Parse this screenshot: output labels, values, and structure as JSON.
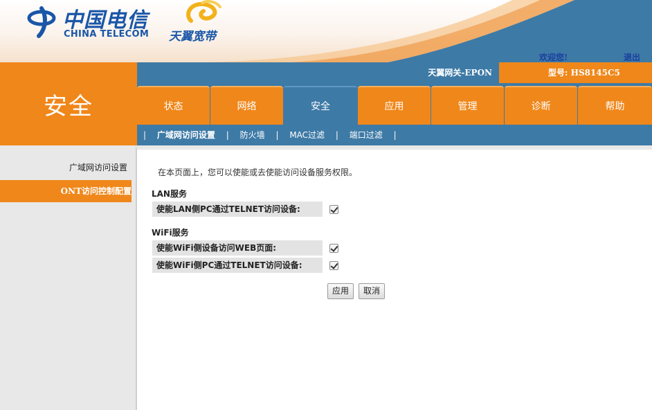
{
  "header": {
    "brand_cn": "中国电信",
    "brand_en": "CHINA TELECOM",
    "sub_brand": "天翼宽带",
    "welcome": "欢迎您!",
    "logout": "退出",
    "colors": {
      "orange": "#f0871a",
      "blue": "#3e7aa6",
      "brand_blue": "#1a56a8"
    }
  },
  "section_title": "安全",
  "info_bar": {
    "gateway": "天翼网关-EPON",
    "model": "型号: HS8145C5"
  },
  "tabs": [
    {
      "label": "状态",
      "active": false
    },
    {
      "label": "网络",
      "active": false
    },
    {
      "label": "安全",
      "active": true
    },
    {
      "label": "应用",
      "active": false
    },
    {
      "label": "管理",
      "active": false
    },
    {
      "label": "诊断",
      "active": false
    },
    {
      "label": "帮助",
      "active": false
    }
  ],
  "subnav": [
    {
      "label": "广域网访问设置",
      "active": true
    },
    {
      "label": "防火墙",
      "active": false
    },
    {
      "label": "MAC过滤",
      "active": false
    },
    {
      "label": "端口过滤",
      "active": false
    }
  ],
  "subnav_separator": "|",
  "sidebar": {
    "items": [
      {
        "label": "广域网访问设置",
        "active": false
      },
      {
        "label": "ONT访问控制配置",
        "active": true
      }
    ]
  },
  "content": {
    "intro": "在本页面上，您可以使能或去使能访问设备服务权限。",
    "lan_title": "LAN服务",
    "lan_rows": [
      {
        "label": "使能LAN侧PC通过TELNET访问设备:",
        "checked": true
      }
    ],
    "wifi_title": "WiFi服务",
    "wifi_rows": [
      {
        "label": "使能WiFi侧设备访问WEB页面:",
        "checked": true
      },
      {
        "label": "使能WiFi侧PC通过TELNET访问设备:",
        "checked": true
      }
    ],
    "apply": "应用",
    "cancel": "取消"
  }
}
